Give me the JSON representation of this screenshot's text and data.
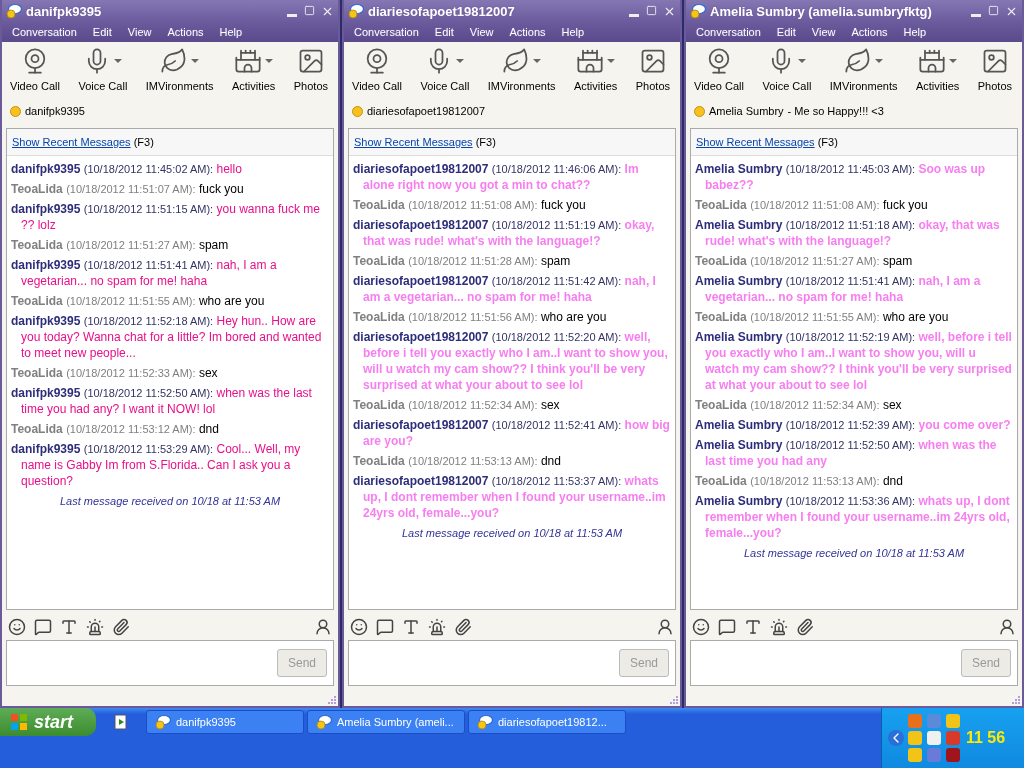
{
  "windows": [
    {
      "title": "danifpk9395",
      "menu": [
        "Conversation",
        "Edit",
        "View",
        "Actions",
        "Help"
      ],
      "toolbar": [
        {
          "kind": "video",
          "label": "Video Call",
          "dropdown": false
        },
        {
          "kind": "voice",
          "label": "Voice Call",
          "dropdown": true
        },
        {
          "kind": "imvironments",
          "label": "IMVironments",
          "dropdown": true
        },
        {
          "kind": "activities",
          "label": "Activities",
          "dropdown": true
        },
        {
          "kind": "photos",
          "label": "Photos",
          "dropdown": false
        }
      ],
      "contact": {
        "name": "danifpk9395"
      },
      "recent_link": "Show Recent Messages",
      "recent_key": "(F3)",
      "messages": [
        {
          "kind": "incoming",
          "sender": "danifpk9395",
          "time": "(10/18/2012 11:45:02 AM):",
          "text": "hello"
        },
        {
          "kind": "outgoing",
          "sender": "TeoaLida",
          "time": "(10/18/2012 11:51:07 AM):",
          "text": "fuck you"
        },
        {
          "kind": "incoming",
          "sender": "danifpk9395",
          "time": "(10/18/2012 11:51:15 AM):",
          "text": "you wanna fuck me ?? lolz"
        },
        {
          "kind": "outgoing",
          "sender": "TeoaLida",
          "time": "(10/18/2012 11:51:27 AM):",
          "text": "spam"
        },
        {
          "kind": "incoming",
          "sender": "danifpk9395",
          "time": "(10/18/2012 11:51:41 AM):",
          "text": "nah, I am a vegetarian...  no spam for me! haha"
        },
        {
          "kind": "outgoing",
          "sender": "TeoaLida",
          "time": "(10/18/2012 11:51:55 AM):",
          "text": "who are you"
        },
        {
          "kind": "incoming",
          "sender": "danifpk9395",
          "time": "(10/18/2012 11:52:18 AM):",
          "text": "Hey hun.. How are you today? Wanna chat for a little? Im bored and wanted to meet new people..."
        },
        {
          "kind": "outgoing",
          "sender": "TeoaLida",
          "time": "(10/18/2012 11:52:33 AM):",
          "text": "sex"
        },
        {
          "kind": "incoming",
          "sender": "danifpk9395",
          "time": "(10/18/2012 11:52:50 AM):",
          "text": "when was the last time you had any? I want it NOW! lol"
        },
        {
          "kind": "outgoing",
          "sender": "TeoaLida",
          "time": "(10/18/2012 11:53:12 AM):",
          "text": "dnd"
        },
        {
          "kind": "incoming",
          "sender": "danifpk9395",
          "time": "(10/18/2012 11:53:29 AM):",
          "text": "Cool... Well, my name is Gabby Im from S.Florida.. Can I ask you a question?"
        }
      ],
      "last_received": "Last message received on 10/18 at 11:53 AM",
      "send": "Send"
    },
    {
      "title": "diariesofapoet19812007",
      "menu": [
        "Conversation",
        "Edit",
        "View",
        "Actions",
        "Help"
      ],
      "toolbar": [
        {
          "kind": "video",
          "label": "Video Call",
          "dropdown": false
        },
        {
          "kind": "voice",
          "label": "Voice Call",
          "dropdown": true
        },
        {
          "kind": "imvironments",
          "label": "IMVironments",
          "dropdown": true
        },
        {
          "kind": "activities",
          "label": "Activities",
          "dropdown": true
        },
        {
          "kind": "photos",
          "label": "Photos",
          "dropdown": false
        }
      ],
      "contact": {
        "name": "diariesofapoet19812007"
      },
      "recent_link": "Show Recent Messages",
      "recent_key": "(F3)",
      "messages": [
        {
          "kind": "incoming-bold",
          "sender": "diariesofapoet19812007",
          "time": "(10/18/2012 11:46:06 AM):",
          "text": "Im alone right now you got a min to chat??"
        },
        {
          "kind": "outgoing",
          "sender": "TeoaLida",
          "time": "(10/18/2012 11:51:08 AM):",
          "text": "fuck you"
        },
        {
          "kind": "incoming-bold",
          "sender": "diariesofapoet19812007",
          "time": "(10/18/2012 11:51:19 AM):",
          "text": "okay, that was rude!  what's with the language!?"
        },
        {
          "kind": "outgoing",
          "sender": "TeoaLida",
          "time": "(10/18/2012 11:51:28 AM):",
          "text": "spam"
        },
        {
          "kind": "incoming-bold",
          "sender": "diariesofapoet19812007",
          "time": "(10/18/2012 11:51:42 AM):",
          "text": "nah, I am a vegetarian...  no spam for me! haha"
        },
        {
          "kind": "outgoing",
          "sender": "TeoaLida",
          "time": "(10/18/2012 11:51:56 AM):",
          "text": "who are you"
        },
        {
          "kind": "incoming-bold",
          "sender": "diariesofapoet19812007",
          "time": "(10/18/2012 11:52:20 AM):",
          "text": "well, before i tell you exactly who I am..I want to show you, will u watch my cam show?? I think you'll be very surprised at what your about to see lol"
        },
        {
          "kind": "outgoing",
          "sender": "TeoaLida",
          "time": "(10/18/2012 11:52:34 AM):",
          "text": "sex"
        },
        {
          "kind": "incoming-bold",
          "sender": "diariesofapoet19812007",
          "time": "(10/18/2012 11:52:41 AM):",
          "text": "how big are you?"
        },
        {
          "kind": "outgoing",
          "sender": "TeoaLida",
          "time": "(10/18/2012 11:53:13 AM):",
          "text": "dnd"
        },
        {
          "kind": "incoming-bold",
          "sender": "diariesofapoet19812007",
          "time": "(10/18/2012 11:53:37 AM):",
          "text": "whats up, I dont remember when I found your username..im 24yrs old, female...you?"
        }
      ],
      "last_received": "Last message received on 10/18 at 11:53 AM",
      "send": "Send"
    },
    {
      "title": "Amelia Sumbry (amelia.sumbryfktg)",
      "menu": [
        "Conversation",
        "Edit",
        "View",
        "Actions",
        "Help"
      ],
      "toolbar": [
        {
          "kind": "video",
          "label": "Video Call",
          "dropdown": false
        },
        {
          "kind": "voice",
          "label": "Voice Call",
          "dropdown": true
        },
        {
          "kind": "imvironments",
          "label": "IMVironments",
          "dropdown": true
        },
        {
          "kind": "activities",
          "label": "Activities",
          "dropdown": true
        },
        {
          "kind": "photos",
          "label": "Photos",
          "dropdown": false
        }
      ],
      "contact": {
        "name": "Amelia Sumbry",
        "status_message": "-  Me so Happy!!! <3"
      },
      "recent_link": "Show Recent Messages",
      "recent_key": "(F3)",
      "messages": [
        {
          "kind": "incoming-bold",
          "sender": "Amelia Sumbry",
          "time": "(10/18/2012 11:45:03 AM):",
          "text": "Soo was up babez??"
        },
        {
          "kind": "outgoing",
          "sender": "TeoaLida",
          "time": "(10/18/2012 11:51:08 AM):",
          "text": "fuck you"
        },
        {
          "kind": "incoming-bold",
          "sender": "Amelia Sumbry",
          "time": "(10/18/2012 11:51:18 AM):",
          "text": "okay, that was rude!  what's with the language!?"
        },
        {
          "kind": "outgoing",
          "sender": "TeoaLida",
          "time": "(10/18/2012 11:51:27 AM):",
          "text": "spam"
        },
        {
          "kind": "incoming-bold",
          "sender": "Amelia Sumbry",
          "time": "(10/18/2012 11:51:41 AM):",
          "text": "nah, I am a vegetarian...  no spam for me! haha"
        },
        {
          "kind": "outgoing",
          "sender": "TeoaLida",
          "time": "(10/18/2012 11:51:55 AM):",
          "text": "who are you"
        },
        {
          "kind": "incoming-bold",
          "sender": "Amelia Sumbry",
          "time": "(10/18/2012 11:52:19 AM):",
          "text": "well, before i tell you exactly who I am..I want to show you, will u watch my cam show?? I think you'll be very surprised at what your about to see lol"
        },
        {
          "kind": "outgoing",
          "sender": "TeoaLida",
          "time": "(10/18/2012 11:52:34 AM):",
          "text": "sex"
        },
        {
          "kind": "incoming-bold",
          "sender": "Amelia Sumbry",
          "time": "(10/18/2012 11:52:39 AM):",
          "text": "you come over?"
        },
        {
          "kind": "incoming-bold",
          "sender": "Amelia Sumbry",
          "time": "(10/18/2012 11:52:50 AM):",
          "text": "when was the last time you had any"
        },
        {
          "kind": "outgoing",
          "sender": "TeoaLida",
          "time": "(10/18/2012 11:53:13 AM):",
          "text": "dnd"
        },
        {
          "kind": "incoming-bold",
          "sender": "Amelia Sumbry",
          "time": "(10/18/2012 11:53:36 AM):",
          "text": "whats up, I dont remember when I found your username..im 24yrs old, female...you?"
        }
      ],
      "last_received": "Last message received on 10/18 at 11:53 AM",
      "send": "Send"
    }
  ],
  "taskbar": {
    "start": "start",
    "tasks": [
      "danifpk9395",
      "Amelia Sumbry (ameli...",
      "diariesofapoet19812..."
    ],
    "clock": "11 56"
  }
}
